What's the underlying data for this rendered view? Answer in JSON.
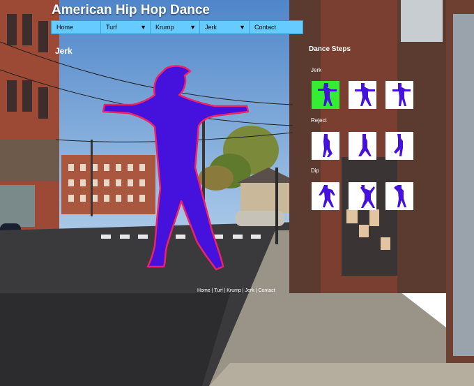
{
  "site": {
    "title": "American Hip Hop Dance"
  },
  "nav": {
    "items": [
      {
        "label": "Home",
        "has_dropdown": false
      },
      {
        "label": "Turf",
        "has_dropdown": true
      },
      {
        "label": "Krump",
        "has_dropdown": true
      },
      {
        "label": "Jerk",
        "has_dropdown": true
      },
      {
        "label": "Contact",
        "has_dropdown": false
      }
    ],
    "arrow": "▼"
  },
  "main": {
    "heading": "Jerk"
  },
  "sidebar": {
    "title": "Dance Steps",
    "groups": [
      {
        "label": "Jerk",
        "thumbs": [
          "jerk-step-1",
          "jerk-step-2",
          "jerk-step-3"
        ]
      },
      {
        "label": "Reject",
        "thumbs": [
          "reject-step-1",
          "reject-step-2",
          "reject-step-3"
        ]
      },
      {
        "label": "Dip",
        "thumbs": [
          "dip-step-1",
          "dip-step-2",
          "dip-step-3"
        ]
      }
    ]
  },
  "footer": {
    "links": [
      "Home",
      "Turf",
      "Krump",
      "Jerk",
      "Contact"
    ],
    "separator": " | "
  },
  "colors": {
    "nav_bg": "#66ccff",
    "silhouette_fill": "#4411dd",
    "silhouette_outline": "#ee2266",
    "active_thumb": "#33ee33"
  }
}
